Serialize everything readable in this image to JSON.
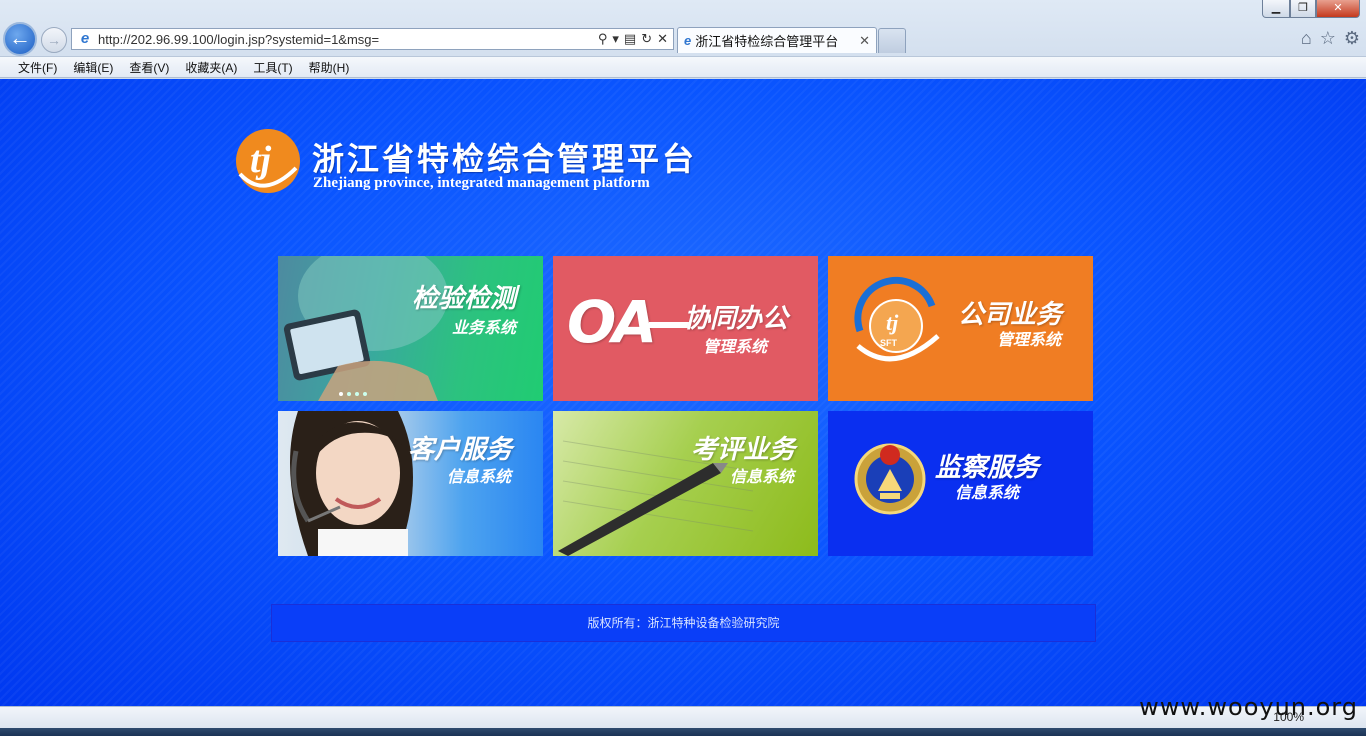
{
  "browser": {
    "url": "http://202.96.99.100/login.jsp?systemid=1&msg=",
    "tab_title": "浙江省特检综合管理平台",
    "menu": [
      "文件(F)",
      "编辑(E)",
      "查看(V)",
      "收藏夹(A)",
      "工具(T)",
      "帮助(H)"
    ],
    "zoom": "100%"
  },
  "header": {
    "title_cn": "浙江省特检综合管理平台",
    "title_en": "Zhejiang province, integrated management platform",
    "logo_text": "tj"
  },
  "tiles": [
    {
      "title": "检验检测",
      "subtitle": "业务系统"
    },
    {
      "title": "协同办公",
      "subtitle": "管理系统",
      "badge": "OA"
    },
    {
      "title": "公司业务",
      "subtitle": "管理系统",
      "badge": "SFT"
    },
    {
      "title": "客户服务",
      "subtitle": "信息系统"
    },
    {
      "title": "考评业务",
      "subtitle": "信息系统"
    },
    {
      "title": "监察服务",
      "subtitle": "信息系统"
    }
  ],
  "footer": {
    "copyright": "版权所有：浙江特种设备检验研究院"
  },
  "watermark": "www.wooyun.org"
}
